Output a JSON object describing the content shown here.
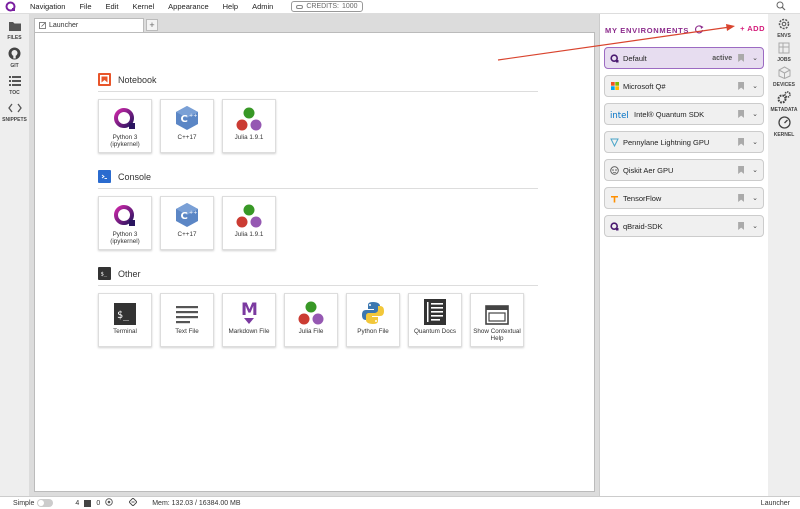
{
  "menubar": {
    "items": [
      "Navigation",
      "File",
      "Edit",
      "Kernel",
      "Appearance",
      "Help",
      "Admin"
    ],
    "credits_label": "CREDITS:",
    "credits_value": "1000"
  },
  "leftbar": {
    "items": [
      {
        "label": "FILES",
        "icon": "folder-icon"
      },
      {
        "label": "GIT",
        "icon": "github-icon"
      },
      {
        "label": "TOC",
        "icon": "list-icon"
      },
      {
        "label": "SNIPPETS",
        "icon": "code-icon"
      }
    ]
  },
  "tabs": [
    {
      "label": "Launcher"
    }
  ],
  "launcher": {
    "sections": [
      {
        "title": "Notebook",
        "cards": [
          "Python 3 (ipykernel)",
          "C++17",
          "Julia 1.9.1"
        ]
      },
      {
        "title": "Console",
        "cards": [
          "Python 3 (ipykernel)",
          "C++17",
          "Julia 1.9.1"
        ]
      },
      {
        "title": "Other",
        "cards": [
          "Terminal",
          "Text File",
          "Markdown File",
          "Julia File",
          "Python File",
          "Quantum Docs",
          "Show Contextual Help"
        ]
      }
    ]
  },
  "environments": {
    "title": "MY ENVIRONMENTS",
    "add_label": "+ ADD",
    "items": [
      {
        "name": "Default",
        "status": "active"
      },
      {
        "name": "Microsoft Q#",
        "status": ""
      },
      {
        "name": "Intel® Quantum SDK",
        "status": ""
      },
      {
        "name": "Pennylane Lightning GPU",
        "status": ""
      },
      {
        "name": "Qiskit Aer GPU",
        "status": ""
      },
      {
        "name": "TensorFlow",
        "status": ""
      },
      {
        "name": "qBraid-SDK",
        "status": ""
      }
    ]
  },
  "rightbar": {
    "items": [
      {
        "label": "ENVS",
        "icon": "gear-icon"
      },
      {
        "label": "JOBS",
        "icon": "jobs-icon"
      },
      {
        "label": "DEVICES",
        "icon": "cube-icon"
      },
      {
        "label": "METADATA",
        "icon": "gears-icon"
      },
      {
        "label": "KERNEL",
        "icon": "gauge-icon"
      }
    ]
  },
  "statusbar": {
    "mode": "Simple",
    "count1": "4",
    "count2": "0",
    "memory": "Mem: 132.03 / 16384.00 MB",
    "right_label": "Launcher"
  },
  "colors": {
    "accent": "#8c2c8c",
    "add": "#d41b7a",
    "arrow": "#d9442e",
    "active_env_bg": "#e7ddf0"
  }
}
